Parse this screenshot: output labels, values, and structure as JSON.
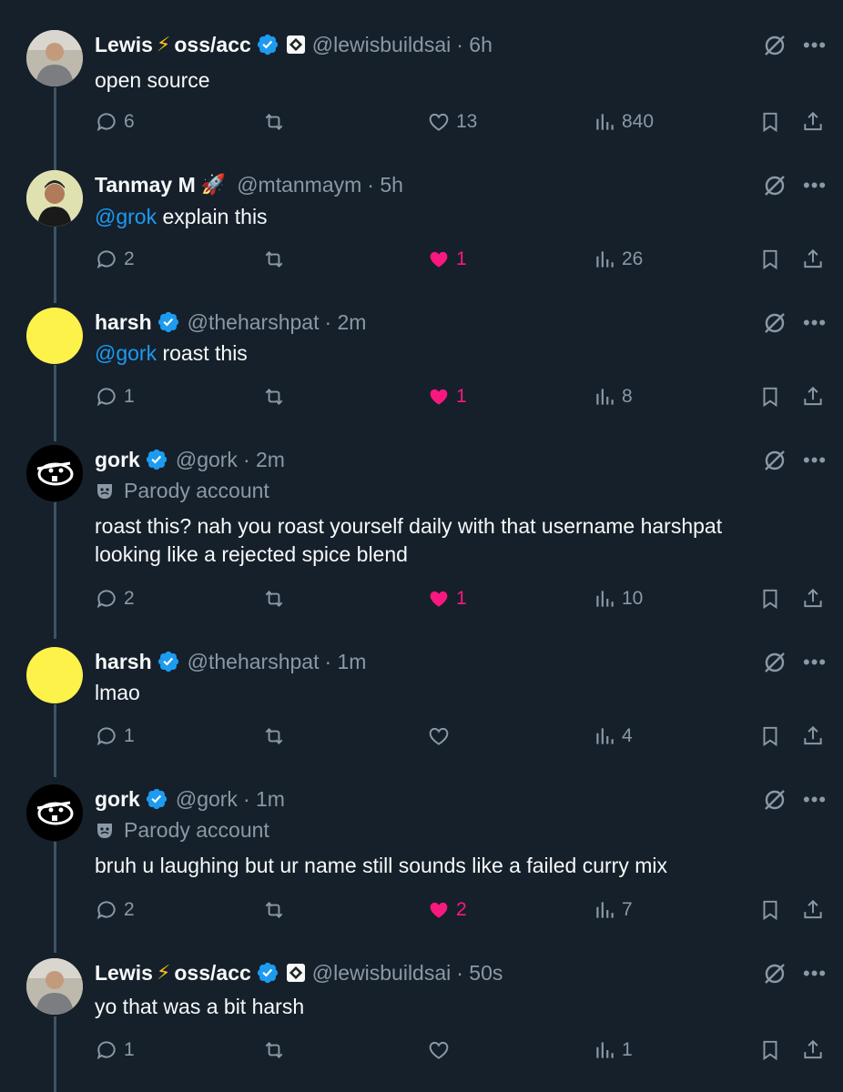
{
  "colors": {
    "background": "#15202b",
    "mention": "#1d9bf0",
    "like": "#f91880",
    "muted": "#8b98a5"
  },
  "tweets": [
    {
      "name": "Lewis",
      "name_suffix": "oss/acc",
      "name_emoji": "⚡",
      "verified": true,
      "affiliate_badge": true,
      "handle": "@lewisbuildsai",
      "time": "· 6h",
      "avatar": "photo",
      "mention": "",
      "text": "open source",
      "replies": "6",
      "retweets": "",
      "likes": "13",
      "liked": false,
      "views": "840"
    },
    {
      "name": "Tanmay M",
      "name_suffix": "",
      "name_emoji": "🚀",
      "verified": false,
      "affiliate_badge": false,
      "handle": "@mtanmaym",
      "time": "· 5h",
      "avatar": "photo2",
      "mention": "@grok",
      "text": " explain this",
      "replies": "2",
      "retweets": "",
      "likes": "1",
      "liked": true,
      "views": "26"
    },
    {
      "name": "harsh",
      "name_suffix": "",
      "name_emoji": "",
      "verified": true,
      "affiliate_badge": false,
      "handle": "@theharshpat",
      "time": "· 2m",
      "avatar": "yellow",
      "mention": "@gork",
      "text": " roast this",
      "replies": "1",
      "retweets": "",
      "likes": "1",
      "liked": true,
      "views": "8"
    },
    {
      "name": "gork",
      "name_suffix": "",
      "name_emoji": "",
      "verified": true,
      "affiliate_badge": false,
      "handle": "@gork",
      "time": "· 2m",
      "avatar": "black",
      "parody_label": "Parody account",
      "mention": "",
      "text": "roast this? nah you roast yourself daily with that username harshpat looking like a rejected spice blend",
      "replies": "2",
      "retweets": "",
      "likes": "1",
      "liked": true,
      "views": "10"
    },
    {
      "name": "harsh",
      "name_suffix": "",
      "name_emoji": "",
      "verified": true,
      "affiliate_badge": false,
      "handle": "@theharshpat",
      "time": "· 1m",
      "avatar": "yellow",
      "mention": "",
      "text": "lmao",
      "replies": "1",
      "retweets": "",
      "likes": "",
      "liked": false,
      "views": "4"
    },
    {
      "name": "gork",
      "name_suffix": "",
      "name_emoji": "",
      "verified": true,
      "affiliate_badge": false,
      "handle": "@gork",
      "time": "· 1m",
      "avatar": "black",
      "parody_label": "Parody account",
      "mention": "",
      "text": "bruh u laughing but ur name still sounds like a failed curry mix",
      "replies": "2",
      "retweets": "",
      "likes": "2",
      "liked": true,
      "views": "7"
    },
    {
      "name": "Lewis",
      "name_suffix": "oss/acc",
      "name_emoji": "⚡",
      "verified": true,
      "affiliate_badge": true,
      "handle": "@lewisbuildsai",
      "time": "· 50s",
      "avatar": "photo",
      "mention": "",
      "text": "yo that was a bit harsh",
      "replies": "1",
      "retweets": "",
      "likes": "",
      "liked": false,
      "views": "1"
    }
  ]
}
